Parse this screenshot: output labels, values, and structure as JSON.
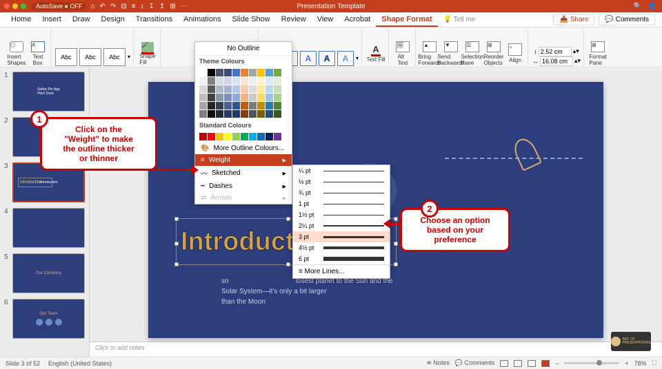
{
  "titlebar": {
    "autosave": "AutoSave ● OFF",
    "title": "Presentation Template",
    "icons": [
      "⌂",
      "↶",
      "↷",
      "⊟",
      "≡",
      "↕",
      "↧",
      "↥",
      "⊞",
      "⋯"
    ]
  },
  "tabs": {
    "list": [
      "Home",
      "Insert",
      "Draw",
      "Design",
      "Transitions",
      "Animations",
      "Slide Show",
      "Review",
      "View",
      "Acrobat",
      "Shape Format"
    ],
    "active": "Shape Format",
    "tellme": "Tell me",
    "share": "Share",
    "comments": "Comments"
  },
  "ribbon": {
    "insert": {
      "shapes": "Insert\nShapes",
      "textbox": "Text\nBox"
    },
    "styles": {
      "abc": "Abc",
      "fill": "Shape\nFill"
    },
    "wordart": {
      "textfill": "Text Fill"
    },
    "arrange": {
      "alt": "Alt\nText",
      "bring": "Bring\nForwards",
      "send": "Send\nBackwards",
      "selpane": "Selection\nPane",
      "reorder": "Reorder\nObjects",
      "align": "Align"
    },
    "size": {
      "h": "2.52 cm",
      "w": "16.08 cm",
      "pane": "Format\nPane"
    }
  },
  "thumbs": [
    {
      "n": "1",
      "label": "Safety Pin App\nPitch Deck",
      "selected": false,
      "dark": true
    },
    {
      "n": "2",
      "label": "",
      "selected": false
    },
    {
      "n": "3",
      "label": "Introduction",
      "selected": true
    },
    {
      "n": "4",
      "label": "",
      "selected": false
    },
    {
      "n": "5",
      "label": "Our Company",
      "selected": false,
      "orange": true
    },
    {
      "n": "6",
      "label": "Our Team",
      "selected": false,
      "orange": true
    }
  ],
  "slide": {
    "title": "Introduction",
    "rest": "uction",
    "sub_prefix": "sn",
    "sub_visible": "losest planet to the Sun and the\nSolar System—it's only a bit larger\nthan the Moon"
  },
  "dropdown": {
    "no_outline": "No Outline",
    "theme": "Theme Colours",
    "standard": "Standard Colours",
    "more_colours": "More Outline Colours...",
    "weight": "Weight",
    "sketched": "Sketched",
    "dashes": "Dashes",
    "arrows": "Arrows",
    "theme_colors": [
      "#ffffff",
      "#000000",
      "#44546a",
      "#3b4a7a",
      "#4472c4",
      "#ed7d31",
      "#a5a5a5",
      "#ffc000",
      "#5b9bd5",
      "#70ad47",
      "#f2f2f2",
      "#7f7f7f",
      "#d6dce5",
      "#cfd5ea",
      "#d9e2f3",
      "#fbe5d6",
      "#ededed",
      "#fff2cc",
      "#deebf7",
      "#e2f0d9",
      "#d9d9d9",
      "#595959",
      "#adb9ca",
      "#a6b3d7",
      "#b4c6e7",
      "#f7cbac",
      "#dbdbdb",
      "#ffe699",
      "#bdd7ee",
      "#c5e0b4",
      "#bfbfbf",
      "#404040",
      "#8497b0",
      "#7c8fc5",
      "#8eaadb",
      "#f4b183",
      "#c9c9c9",
      "#ffd966",
      "#9dc3e6",
      "#a9d18e",
      "#a6a6a6",
      "#262626",
      "#333f50",
      "#4a5d9b",
      "#2f5597",
      "#c55a11",
      "#7b7b7b",
      "#bf9000",
      "#2e75b6",
      "#548235",
      "#808080",
      "#0d0d0d",
      "#222a35",
      "#2c3863",
      "#1f3864",
      "#843c0c",
      "#525252",
      "#7f6000",
      "#1f4e79",
      "#385723"
    ],
    "std_colors": [
      "#c00000",
      "#ff0000",
      "#ffc000",
      "#ffff00",
      "#92d050",
      "#00b050",
      "#00b0f0",
      "#0070c0",
      "#002060",
      "#7030a0"
    ]
  },
  "weights": {
    "list": [
      "¼ pt",
      "½ pt",
      "¾ pt",
      "1 pt",
      "1½ pt",
      "2¼ pt",
      "3 pt",
      "4½ pt",
      "6 pt"
    ],
    "selected": "3 pt",
    "more": "More Lines..."
  },
  "callout1": {
    "num": "1",
    "text": "Click on the\n\"Weight\" to make\nthe outline thicker\nor thinner"
  },
  "callout2": {
    "num": "2",
    "text": "Choose an option\nbased on your\npreference"
  },
  "notes": "Click to add notes",
  "status": {
    "slide": "Slide 3 of 52",
    "lang": "English (United States)",
    "notes": "Notes",
    "comments": "Comments",
    "zoom": "78%"
  },
  "watermark": "ART OF\nPRESENTATIONS"
}
